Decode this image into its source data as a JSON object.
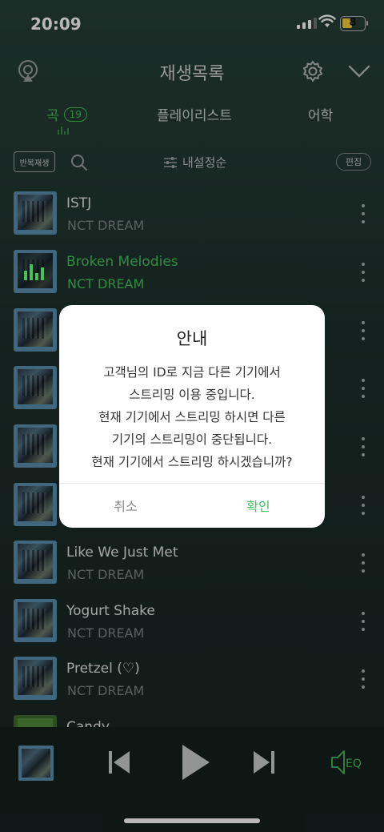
{
  "status": {
    "time": "20:09",
    "battery": "8"
  },
  "header": {
    "title": "재생목록"
  },
  "tabs": {
    "song_label": "곡",
    "song_count": "19",
    "playlist_label": "플레이리스트",
    "vocab_label": "어학"
  },
  "toolbar": {
    "repeat_label": "반복재생",
    "sort_label": "내설정순",
    "edit_label": "편집"
  },
  "songs": [
    {
      "title": "ISTJ",
      "artist": "NCT DREAM"
    },
    {
      "title": "Broken Melodies",
      "artist": "NCT DREAM",
      "playing": true
    },
    {
      "title": "",
      "artist": ""
    },
    {
      "title": "",
      "artist": ""
    },
    {
      "title": "",
      "artist": ""
    },
    {
      "title": "",
      "artist": ""
    },
    {
      "title": "Like We Just Met",
      "artist": "NCT DREAM"
    },
    {
      "title": "Yogurt Shake",
      "artist": "NCT DREAM"
    },
    {
      "title": "Pretzel (♡)",
      "artist": "NCT DREAM"
    },
    {
      "title": "Candy",
      "artist": ""
    }
  ],
  "dialog": {
    "title": "안내",
    "message_lines": [
      "고객님의 ID로 지금 다른 기기에서",
      "스트리밍 이용 중입니다.",
      "현재 기기에서 스트리밍 하시면 다른",
      "기기의 스트리밍이 중단됩니다.",
      "현재 기기에서 스트리밍 하시겠습니까?"
    ],
    "cancel_label": "취소",
    "confirm_label": "확인"
  },
  "player": {
    "eq_label": "EQ"
  },
  "colors": {
    "accent": "#44c35b",
    "background": "#1d302b",
    "dialog": "#ffffff"
  }
}
